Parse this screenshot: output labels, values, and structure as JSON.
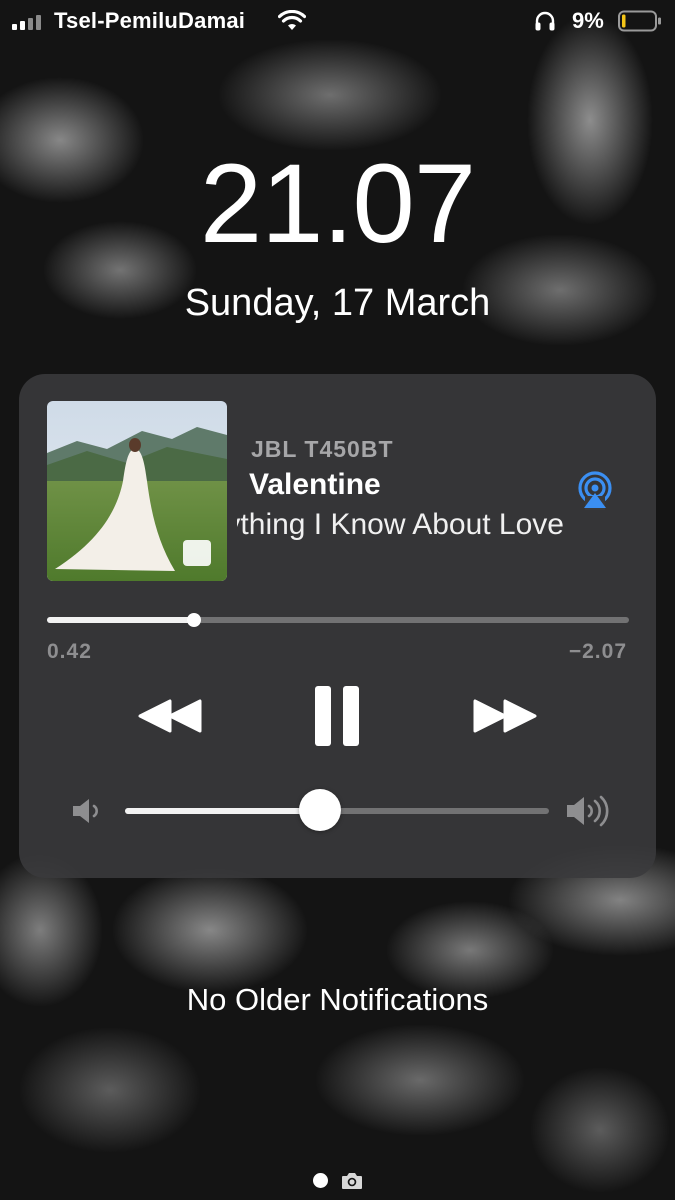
{
  "status_bar": {
    "carrier": "Tsel-PemiluDamai",
    "signal_bars": 2,
    "battery_percent": "9%",
    "battery_level": 0.09,
    "icons": [
      "signal-icon",
      "wifi-icon",
      "headphones-icon",
      "battery-icon"
    ]
  },
  "lock_screen": {
    "time": "21.07",
    "date": "Sunday, 17 March"
  },
  "now_playing": {
    "output_device": "JBL T450BT",
    "track_title": "Valentine",
    "album_title": "Everything I Know About Love",
    "artwork_icon": "album-artwork",
    "airplay_icon": "airplay-icon",
    "airplay_color": "#3b8ff2",
    "elapsed": "0.42",
    "remaining": "−2.07",
    "progress_fraction": 0.252,
    "volume_fraction": 0.46,
    "controls": [
      "rewind-icon",
      "pause-icon",
      "fast-forward-icon"
    ],
    "volume_icons": [
      "volume-low-icon",
      "volume-high-icon"
    ]
  },
  "notifications": {
    "empty_text": "No Older Notifications"
  },
  "pager": {
    "icons": [
      "page-dot",
      "camera-icon"
    ]
  }
}
